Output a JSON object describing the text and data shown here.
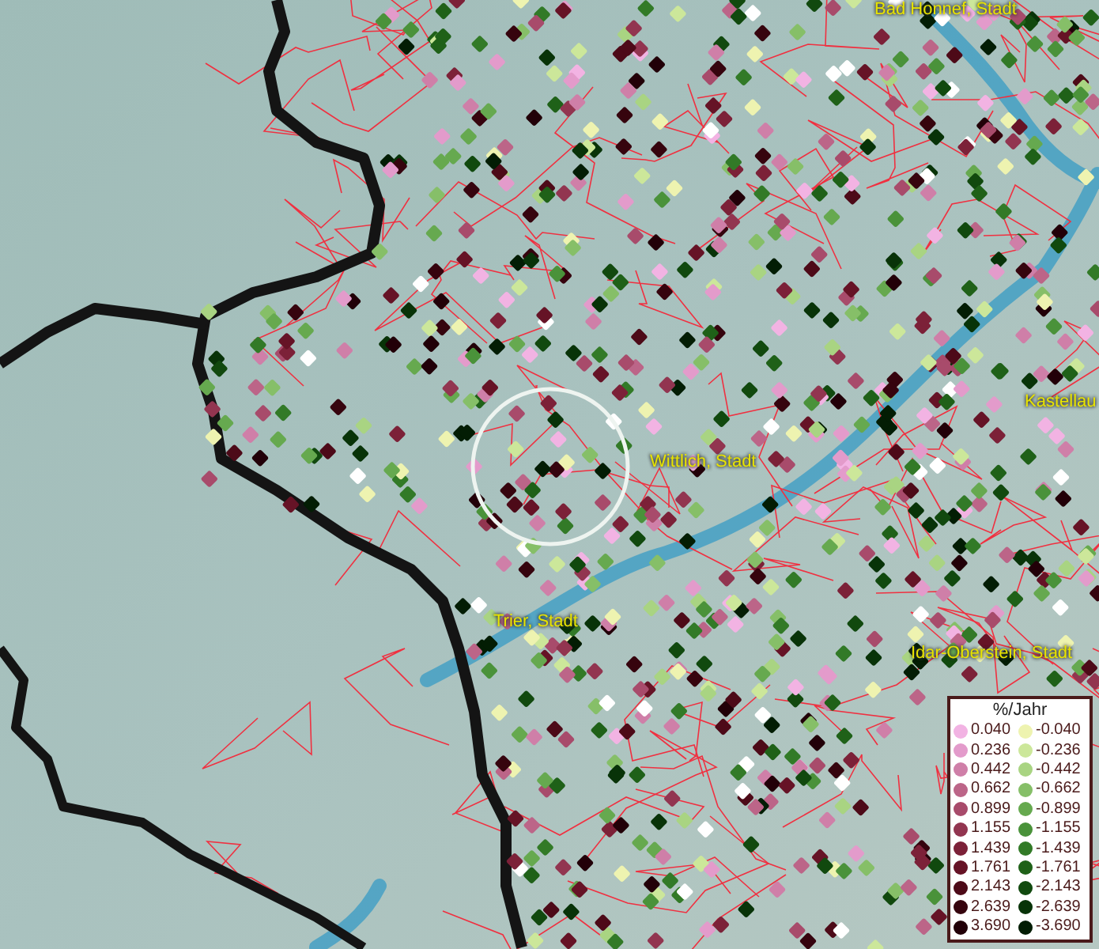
{
  "map": {
    "place_labels": [
      {
        "text": "Bad Honnef, Stadt"
      },
      {
        "text": "Kastellau"
      },
      {
        "text": "Wittlich, Stadt"
      },
      {
        "text": "Trier, Stadt"
      },
      {
        "text": "Idar-Oberstein, Stadt"
      }
    ]
  },
  "legend": {
    "title": "%/Jahr",
    "positive": [
      {
        "label": "0.040",
        "color": "#f2b3e3"
      },
      {
        "label": "0.236",
        "color": "#e39bcb"
      },
      {
        "label": "0.442",
        "color": "#cf7fa8"
      },
      {
        "label": "0.662",
        "color": "#bc6588"
      },
      {
        "label": "0.899",
        "color": "#a84b6b"
      },
      {
        "label": "1.155",
        "color": "#923550"
      },
      {
        "label": "1.439",
        "color": "#7c2138"
      },
      {
        "label": "1.761",
        "color": "#661326"
      },
      {
        "label": "2.143",
        "color": "#4d0a18"
      },
      {
        "label": "2.639",
        "color": "#36040e"
      },
      {
        "label": "3.690",
        "color": "#220008"
      }
    ],
    "negative": [
      {
        "label": "-0.040",
        "color": "#eef3b0"
      },
      {
        "label": "-0.236",
        "color": "#cce79a"
      },
      {
        "label": "-0.442",
        "color": "#a9d482"
      },
      {
        "label": "-0.662",
        "color": "#86bf68"
      },
      {
        "label": "-0.899",
        "color": "#66a94f"
      },
      {
        "label": "-1.155",
        "color": "#4a923a"
      },
      {
        "label": "-1.439",
        "color": "#327a27"
      },
      {
        "label": "-1.761",
        "color": "#1f6118"
      },
      {
        "label": "-2.143",
        "color": "#11490e"
      },
      {
        "label": "-2.639",
        "color": "#083308"
      },
      {
        "label": "-3.690",
        "color": "#031d04"
      }
    ]
  }
}
